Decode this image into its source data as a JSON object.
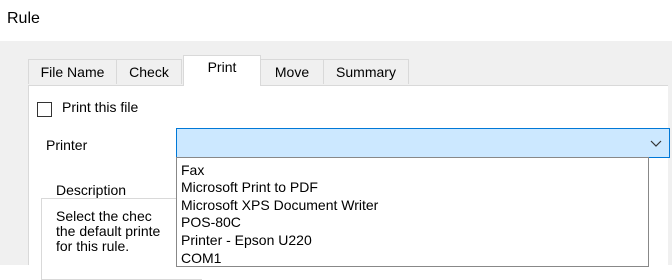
{
  "window": {
    "title": "Rule"
  },
  "tabs": [
    {
      "label": "File Name"
    },
    {
      "label": "Check"
    },
    {
      "label": "Print"
    },
    {
      "label": "Move"
    },
    {
      "label": "Summary"
    }
  ],
  "print": {
    "checkbox_label": "Print this file",
    "checked": false,
    "printer_label": "Printer",
    "printer_value": ""
  },
  "description": {
    "legend": "Description",
    "lines": [
      "Select the chec",
      "the default printe",
      "for this rule."
    ]
  },
  "dropdown": {
    "options": [
      "Fax",
      "Microsoft Print to PDF",
      "Microsoft XPS Document Writer",
      "POS-80C",
      "Printer - Epson U220",
      "COM1"
    ]
  },
  "colors": {
    "accent": "#0078d7",
    "selection": "#cce8ff"
  }
}
